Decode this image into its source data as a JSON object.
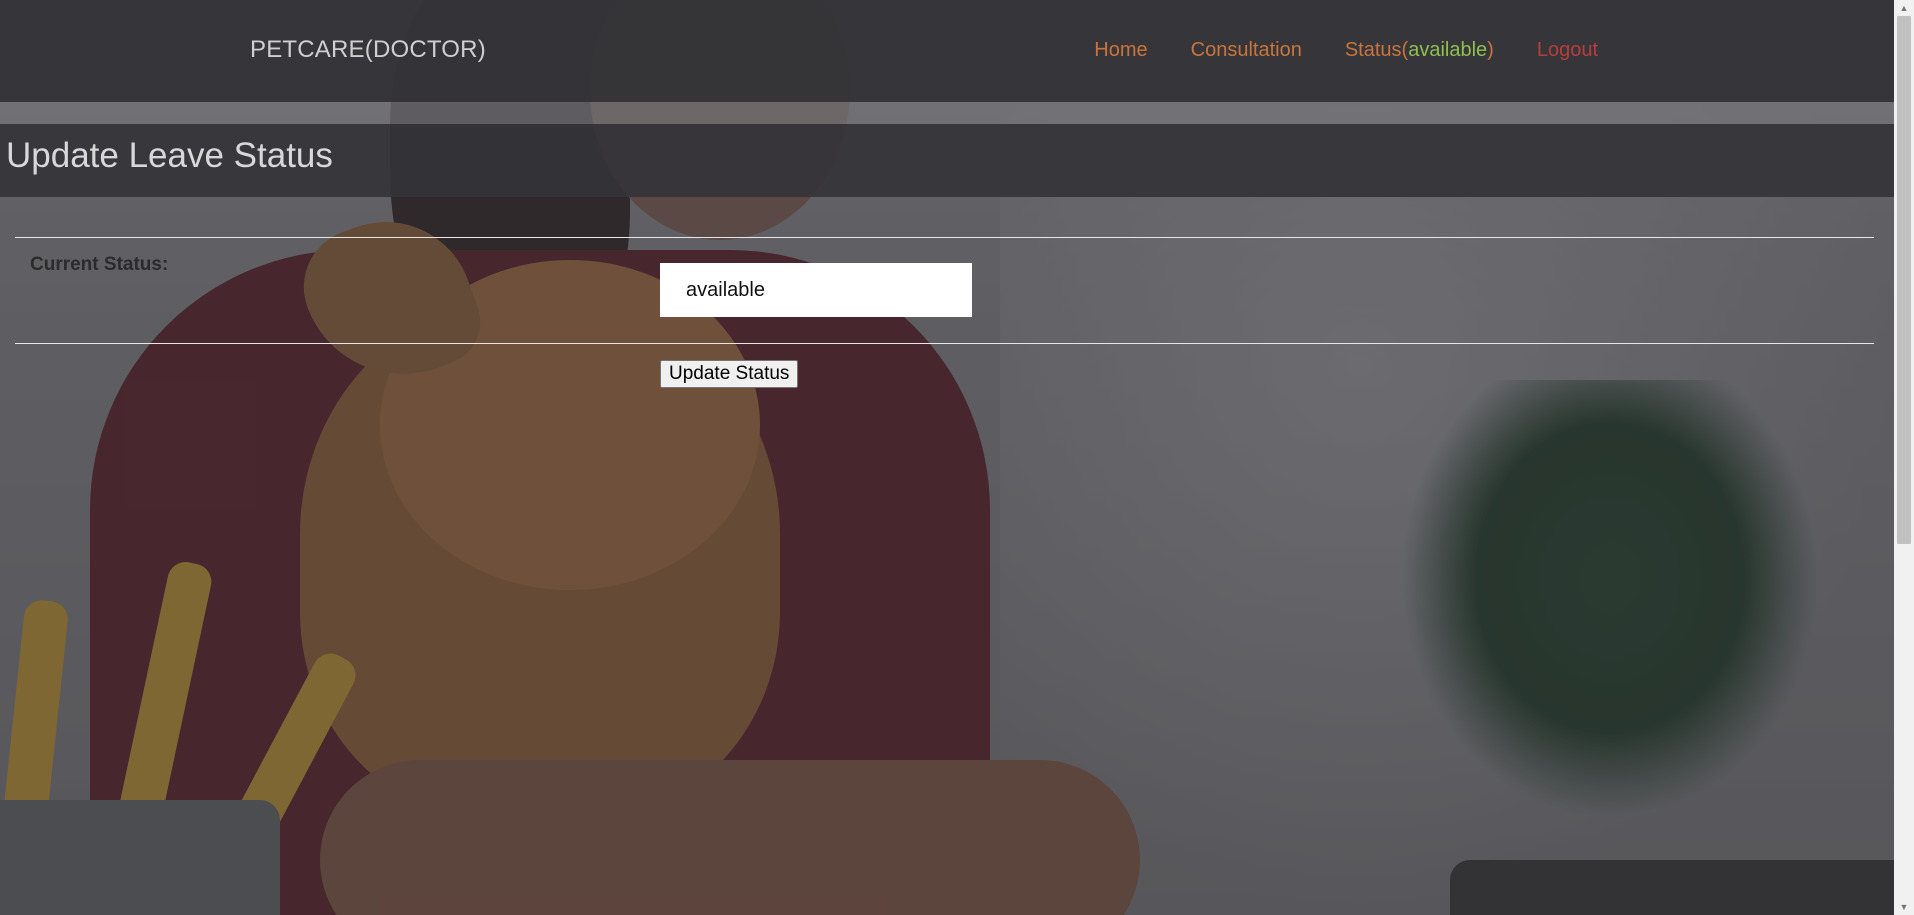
{
  "brand": "PETCARE(DOCTOR)",
  "nav": {
    "home": "Home",
    "consultation": "Consultation",
    "status_prefix": "Status(",
    "status_value": "available",
    "status_suffix": ")",
    "logout": "Logout"
  },
  "page_title": "Update Leave Status",
  "form": {
    "current_status_label": "Current Status:",
    "current_status_value": "available",
    "submit_label": "Update Status"
  },
  "colors": {
    "nav_link": "#c8743c",
    "status_value": "#8fbf50",
    "logout": "#b83d3d",
    "navbar_bg": "#343438"
  },
  "icons": {
    "scroll_up": "triangle-up-icon",
    "scroll_down": "triangle-down-icon"
  }
}
